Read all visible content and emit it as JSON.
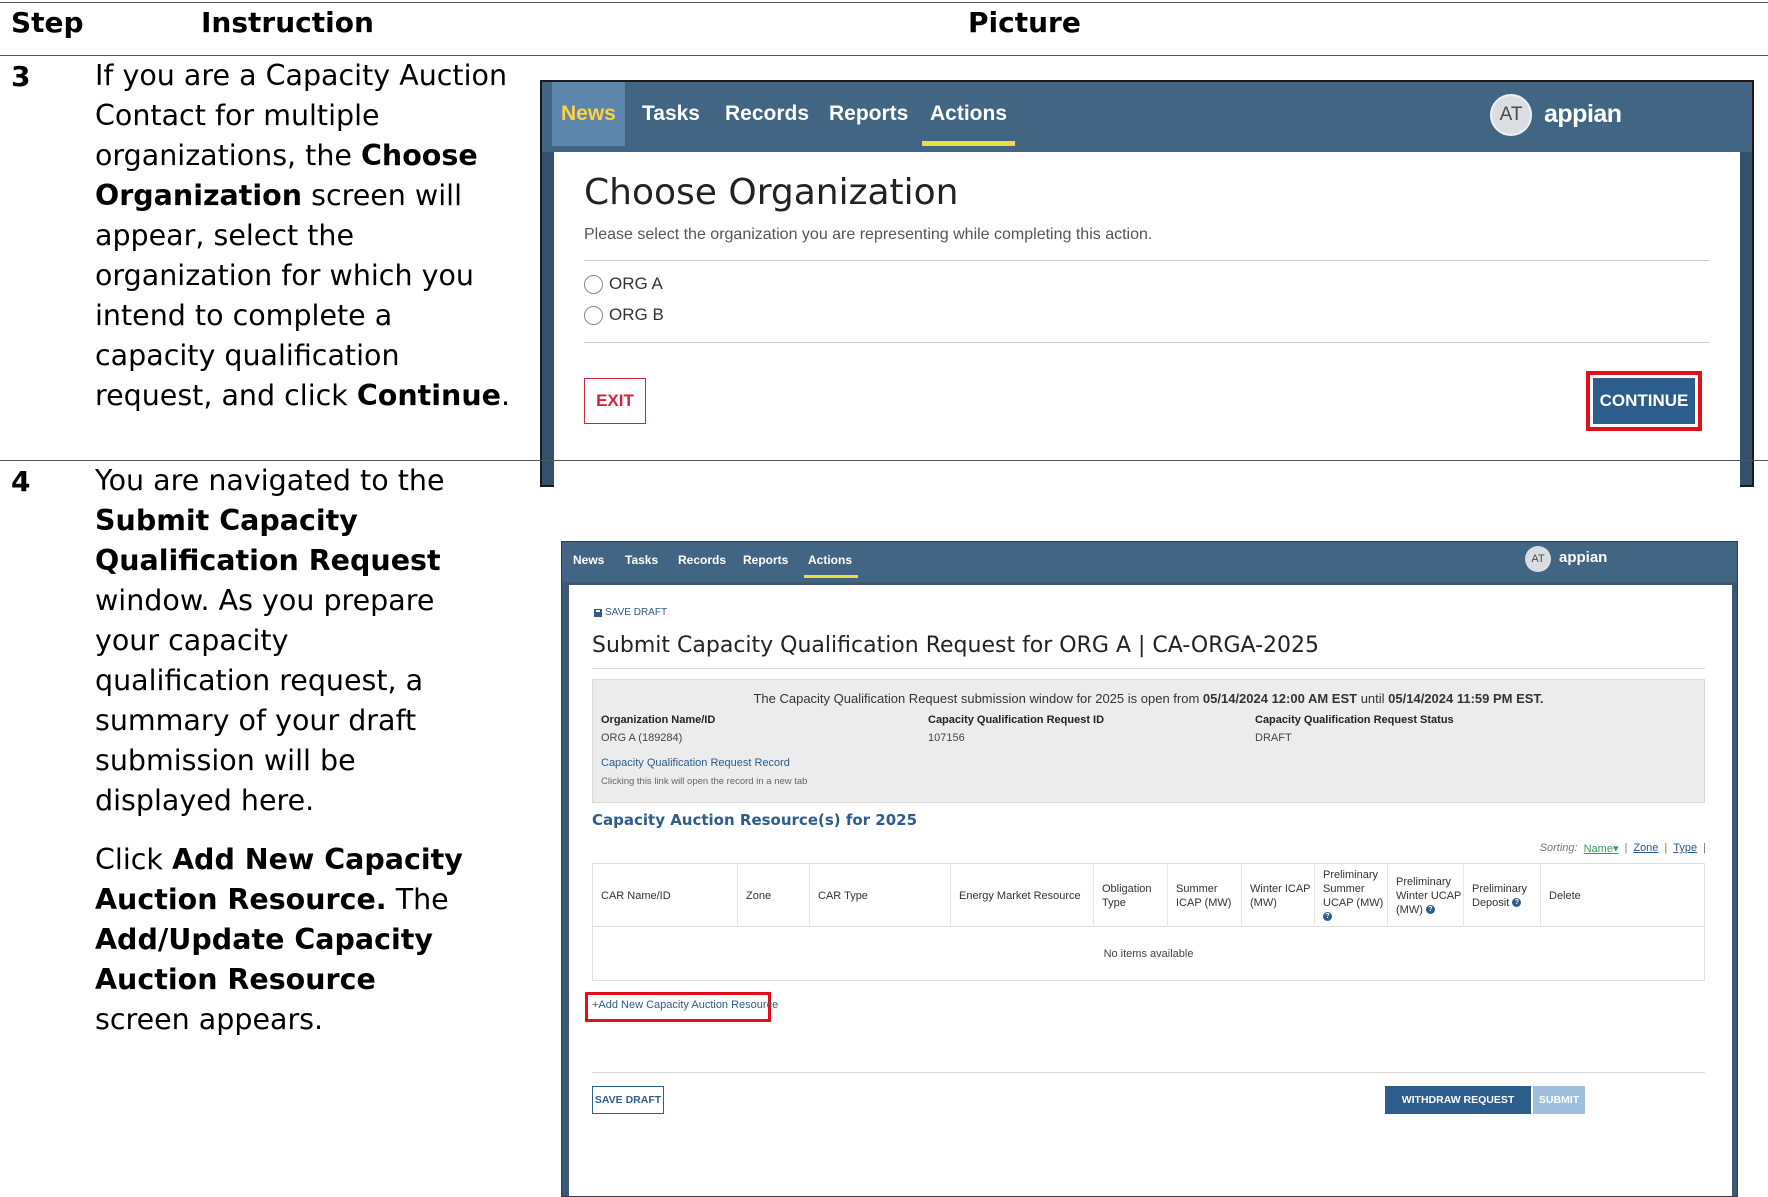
{
  "headers": {
    "step": "Step",
    "instruction": "Instruction",
    "picture": "Picture"
  },
  "row1": {
    "step": "3",
    "text": [
      {
        "t": "If you are a Capacity Auction Contact for multiple organizations, the ",
        "b": false
      },
      {
        "t": "Choose Organization",
        "b": true
      },
      {
        "t": " screen will appear, select the organization for which you intend to complete a capacity qualification request, and click ",
        "b": false
      },
      {
        "t": "Continue",
        "b": true
      },
      {
        "t": ".",
        "b": false
      }
    ],
    "screen": {
      "nav": [
        "News",
        "Tasks",
        "Records",
        "Reports",
        "Actions"
      ],
      "active_tab": "Actions",
      "avatar": "AT",
      "logo": "appian",
      "title": "Choose Organization",
      "subtitle": "Please select the organization you are representing while completing this action.",
      "options": [
        "ORG A",
        "ORG B"
      ],
      "exit_label": "EXIT",
      "continue_label": "CONTINUE",
      "highlight_color": "#e3101c"
    }
  },
  "row2": {
    "step": "4",
    "para1": [
      {
        "t": "You are navigated to the ",
        "b": false
      },
      {
        "t": "Submit Capacity Qualification Request",
        "b": true
      },
      {
        "t": " window. As you prepare your capacity qualification request, a summary of your draft submission will be displayed here.",
        "b": false
      }
    ],
    "para2": [
      {
        "t": "Click ",
        "b": false
      },
      {
        "t": "Add New Capacity Auction Resource.",
        "b": true
      },
      {
        "t": " The ",
        "b": false
      },
      {
        "t": "Add/Update Capacity Auction Resource",
        "b": true
      },
      {
        "t": " screen appears.",
        "b": false
      }
    ],
    "screen": {
      "nav": [
        "News",
        "Tasks",
        "Records",
        "Reports",
        "Actions"
      ],
      "active_tab": "Actions",
      "avatar": "AT",
      "logo": "appian",
      "save_draft_top": "SAVE DRAFT",
      "title": "Submit Capacity Qualification Request for ORG A | CA-ORGA-2025",
      "banner": [
        {
          "t": "The Capacity Qualification Request submission window for 2025 is open from ",
          "b": false
        },
        {
          "t": "05/14/2024 12:00 AM EST",
          "b": true
        },
        {
          "t": " until ",
          "b": false
        },
        {
          "t": "05/14/2024 11:59 PM EST.",
          "b": true
        }
      ],
      "fields": [
        {
          "label": "Organization Name/ID",
          "value": "ORG A (189284)"
        },
        {
          "label": "Capacity Qualification Request ID",
          "value": "107156"
        },
        {
          "label": "Capacity Qualification Request Status",
          "value": "DRAFT"
        }
      ],
      "record_link": "Capacity Qualification Request Record",
      "record_hint": "Clicking this link will open the record in a new tab",
      "section_title": "Capacity Auction Resource(s) for 2025",
      "sorting": {
        "label": "Sorting:",
        "options": [
          "Name",
          "Zone",
          "Type"
        ],
        "selected": "Name"
      },
      "columns": [
        "CAR Name/ID",
        "Zone",
        "CAR Type",
        "Energy Market Resource",
        "Obligation Type",
        "Summer ICAP (MW)",
        "Winter ICAP (MW)",
        "Preliminary Summer UCAP (MW)",
        "Preliminary Winter UCAP (MW)",
        "Preliminary Deposit",
        "Delete"
      ],
      "empty_text": "No items available",
      "add_link": "+Add New Capacity Auction Resource",
      "save_draft_label": "SAVE DRAFT",
      "withdraw_label": "WITHDRAW REQUEST",
      "submit_label": "SUBMIT"
    }
  }
}
